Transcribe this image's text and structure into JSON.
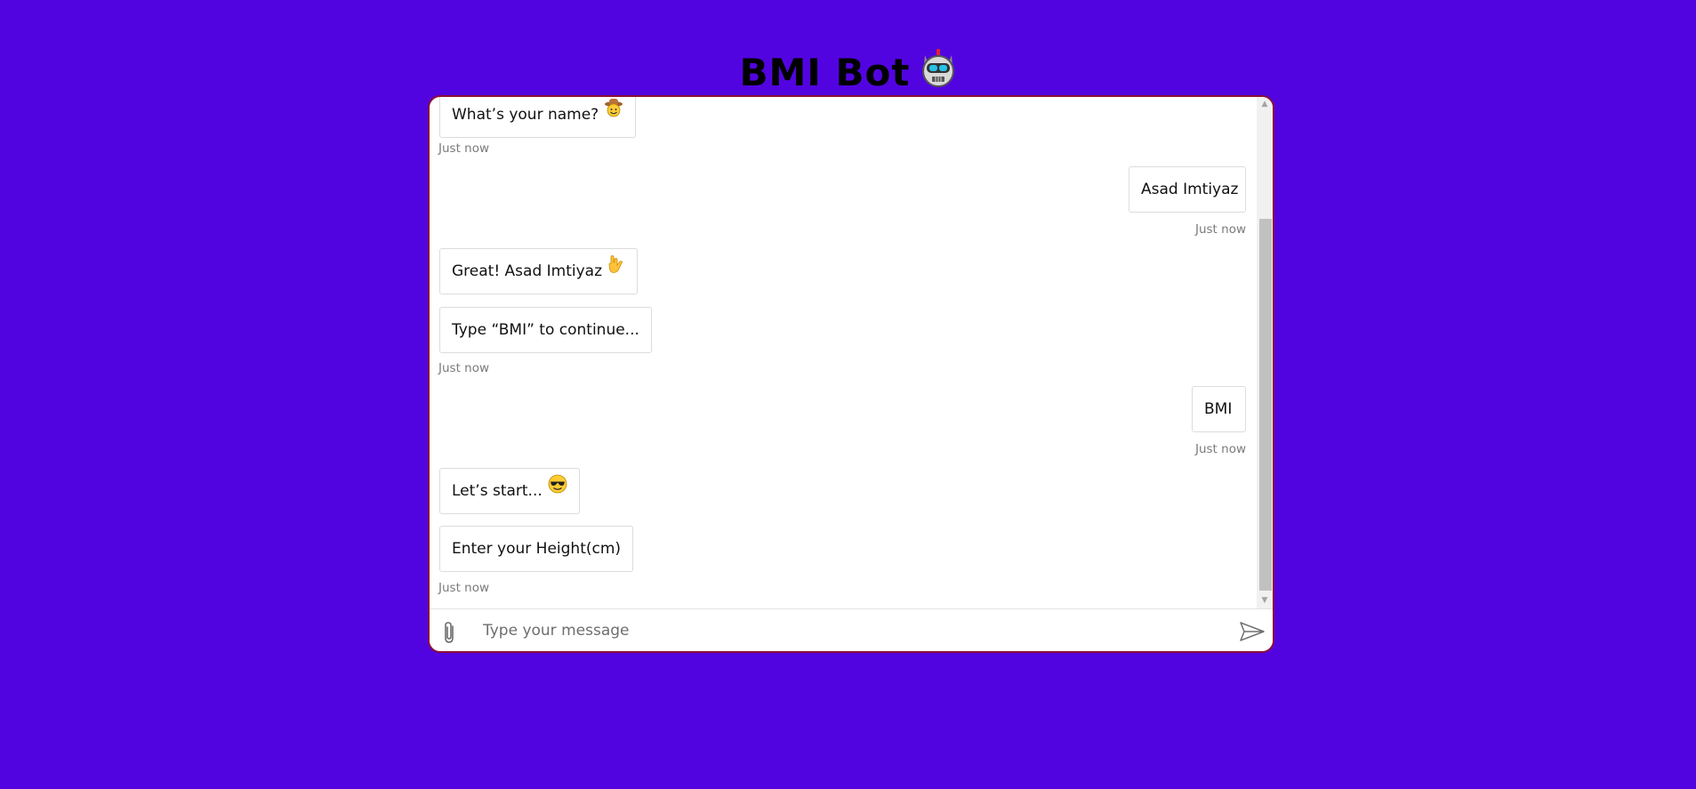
{
  "header": {
    "title": "BMI Bot",
    "icon": "robot-icon"
  },
  "messages": [
    {
      "sender": "bot",
      "text": "What’s your name?",
      "emoji": "cowboy-face-icon"
    },
    {
      "sender": "bot",
      "timestamp": "Just now"
    },
    {
      "sender": "user",
      "text": "Asad Imtiyaz",
      "timestamp": "Just now"
    },
    {
      "sender": "bot",
      "text": "Great! Asad Imtiyaz",
      "emoji": "love-you-gesture-icon"
    },
    {
      "sender": "bot",
      "text": "Type “BMI” to continue...",
      "timestamp": "Just now"
    },
    {
      "sender": "user",
      "text": "BMI",
      "timestamp": "Just now"
    },
    {
      "sender": "bot",
      "text": "Let’s start...",
      "emoji": "smiling-face-with-sunglasses-icon"
    },
    {
      "sender": "bot",
      "text": "Enter your Height(cm)",
      "timestamp": "Just now"
    }
  ],
  "composer": {
    "placeholder": "Type your message",
    "value": "",
    "attach_icon": "paperclip-icon",
    "send_icon": "send-icon"
  },
  "colors": {
    "background": "#5204e0",
    "window_border": "#8a0f36",
    "bubble_border": "#dcdcdc",
    "timestamp": "#7a7a7a"
  }
}
